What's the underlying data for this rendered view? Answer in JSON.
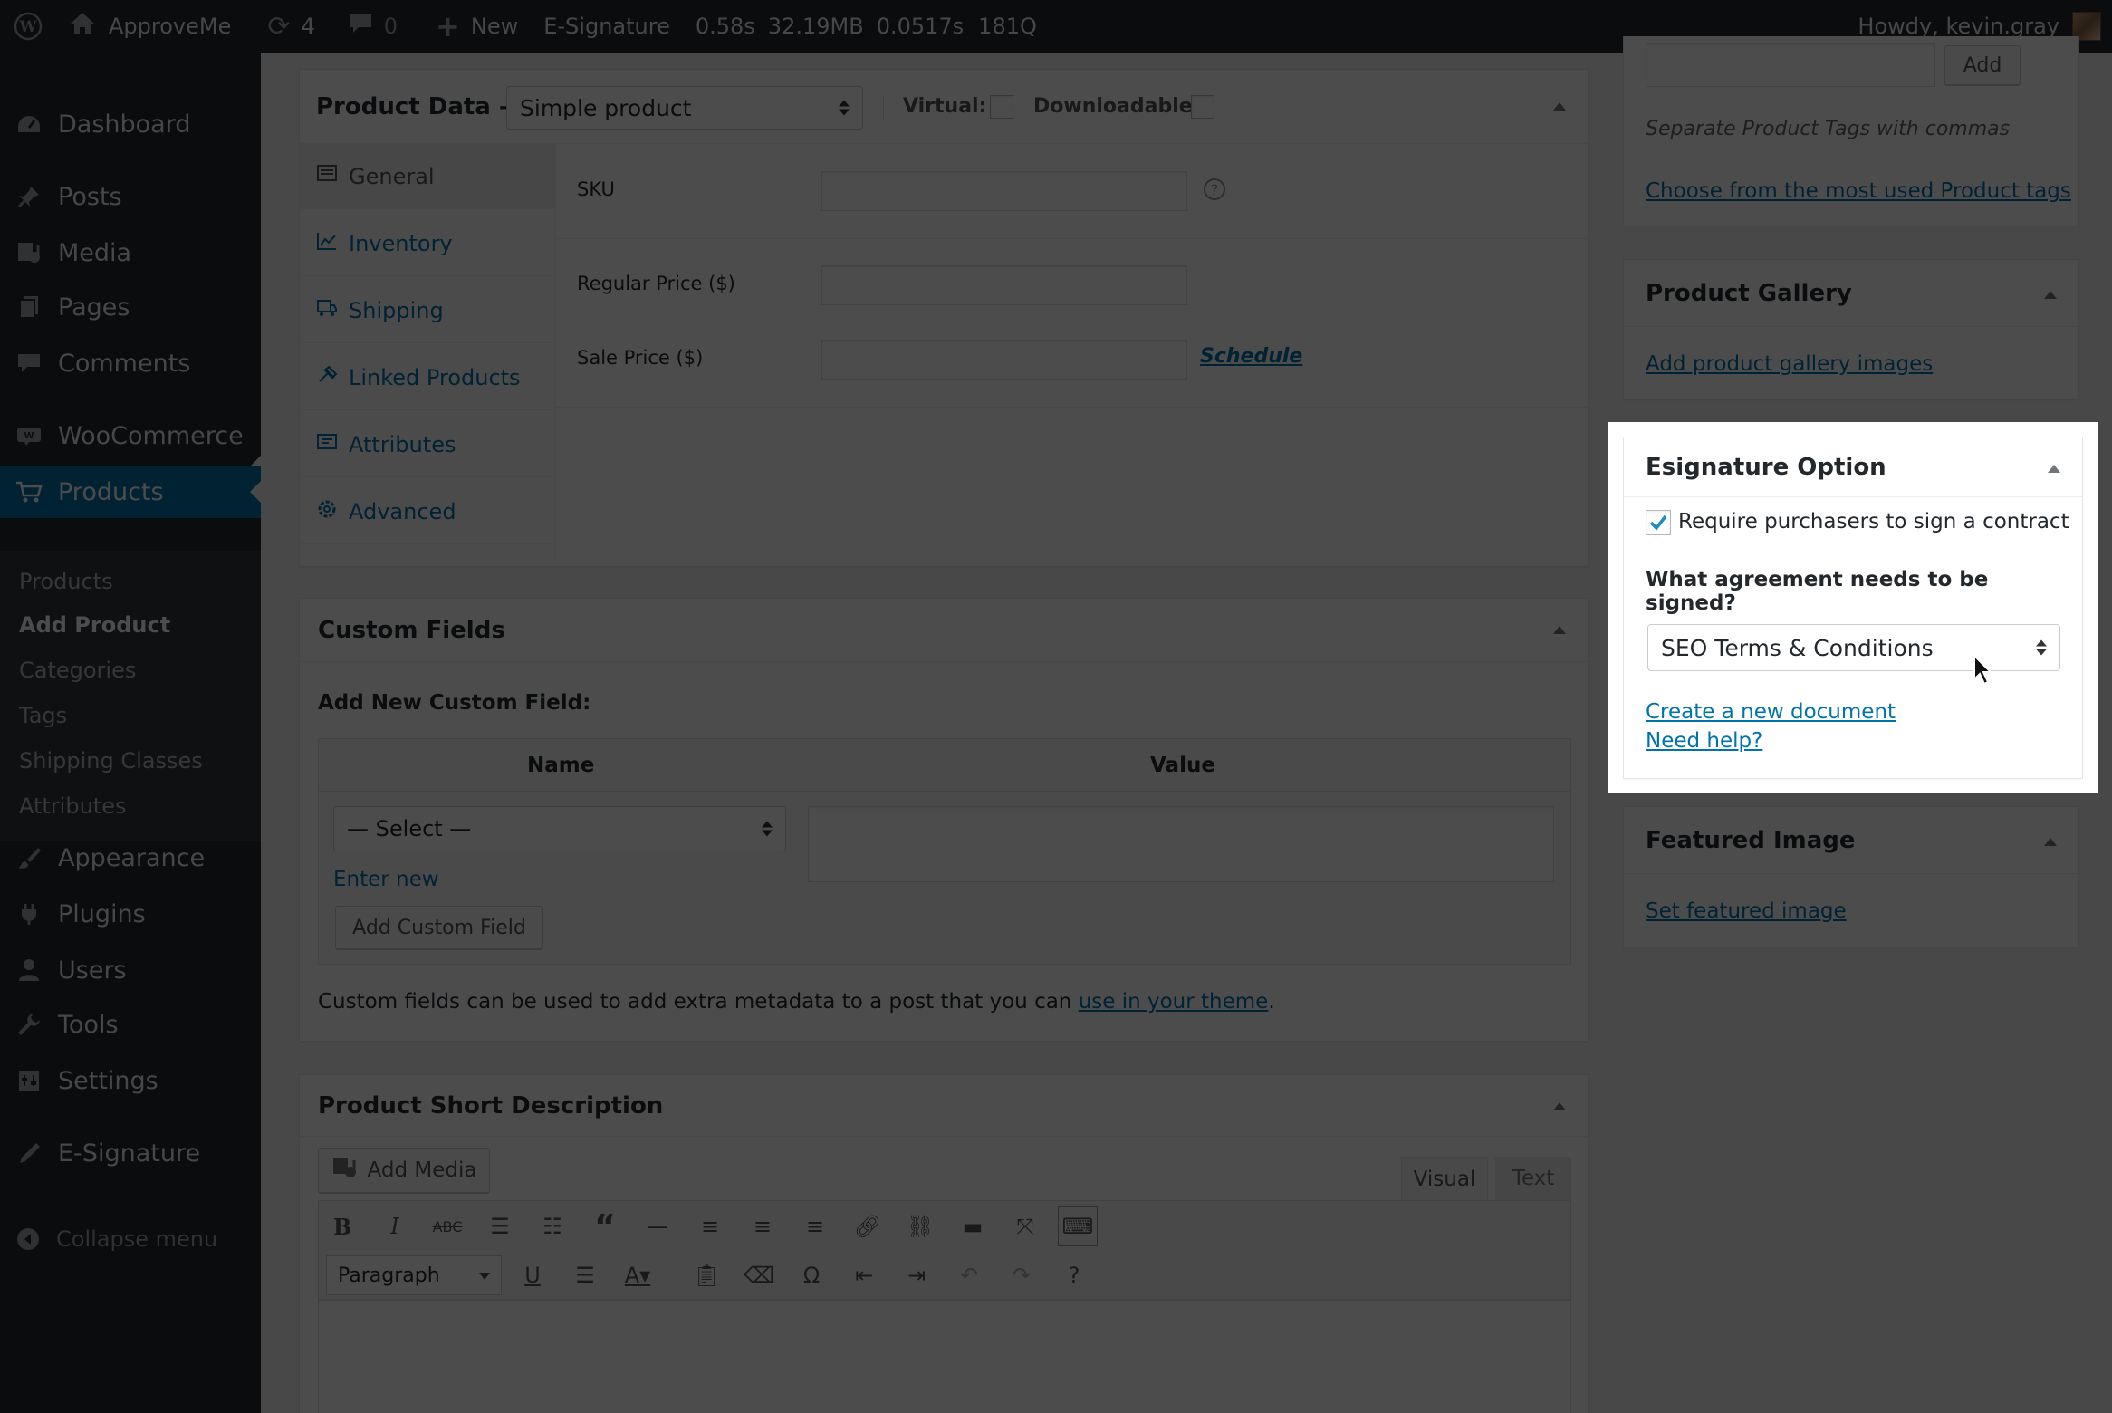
{
  "adminbar": {
    "site_name": "ApproveMe",
    "updates_count": "4",
    "comments_count": "0",
    "new_label": "New",
    "esig_label": "E-Signature",
    "stat_time": "0.58s",
    "stat_mem": "32.19MB",
    "stat_query_time": "0.0517s",
    "stat_queries": "181Q",
    "howdy": "Howdy, kevin.gray"
  },
  "sidebar": {
    "items": [
      {
        "label": "Dashboard",
        "icon": "dashboard-icon"
      },
      {
        "label": "Posts",
        "icon": "pin-icon"
      },
      {
        "label": "Media",
        "icon": "media-icon"
      },
      {
        "label": "Pages",
        "icon": "pages-icon"
      },
      {
        "label": "Comments",
        "icon": "comment-icon"
      },
      {
        "label": "WooCommerce",
        "icon": "woocommerce-icon"
      },
      {
        "label": "Products",
        "icon": "cart-icon"
      },
      {
        "label": "Appearance",
        "icon": "brush-icon"
      },
      {
        "label": "Plugins",
        "icon": "plugin-icon"
      },
      {
        "label": "Users",
        "icon": "user-icon"
      },
      {
        "label": "Tools",
        "icon": "wrench-icon"
      },
      {
        "label": "Settings",
        "icon": "settings-icon"
      },
      {
        "label": "E-Signature",
        "icon": "pen-icon"
      }
    ],
    "submenu": [
      "Products",
      "Add Product",
      "Categories",
      "Tags",
      "Shipping Classes",
      "Attributes"
    ],
    "collapse_label": "Collapse menu"
  },
  "product_data": {
    "title": "Product Data —",
    "type_value": "Simple product",
    "virtual_label": "Virtual:",
    "downloadable_label": "Downloadable:",
    "tabs": [
      "General",
      "Inventory",
      "Shipping",
      "Linked Products",
      "Attributes",
      "Advanced"
    ],
    "sku_label": "SKU",
    "regular_price_label": "Regular Price ($)",
    "sale_price_label": "Sale Price ($)",
    "schedule_label": "Schedule"
  },
  "custom_fields": {
    "title": "Custom Fields",
    "add_new_label": "Add New Custom Field:",
    "name_header": "Name",
    "value_header": "Value",
    "select_value": "— Select —",
    "enter_new": "Enter new",
    "add_button": "Add Custom Field",
    "note_before": "Custom fields can be used to add extra metadata to a post that you can ",
    "note_link": "use in your theme",
    "note_after": "."
  },
  "short_description": {
    "title": "Product Short Description",
    "add_media": "Add Media",
    "tab_visual": "Visual",
    "tab_text": "Text",
    "format_value": "Paragraph"
  },
  "tags_box": {
    "add_button": "Add",
    "hint": "Separate Product Tags with commas",
    "most_used_link": "Choose from the most used Product tags"
  },
  "gallery_box": {
    "title": "Product Gallery",
    "link": "Add product gallery images"
  },
  "esig_box": {
    "title": "Esignature Option",
    "checkbox_label": "Require purchasers to sign a contract",
    "checkbox_checked": true,
    "question": "What agreement needs to be signed?",
    "select_value": "SEO Terms & Conditions",
    "create_link": "Create a new document",
    "help_link": "Need help?"
  },
  "featured_box": {
    "title": "Featured Image",
    "link": "Set featured image"
  },
  "colors": {
    "admin_dark": "#23282d",
    "accent": "#0073aa",
    "overlay": "rgba(0,0,0,0.70)"
  }
}
